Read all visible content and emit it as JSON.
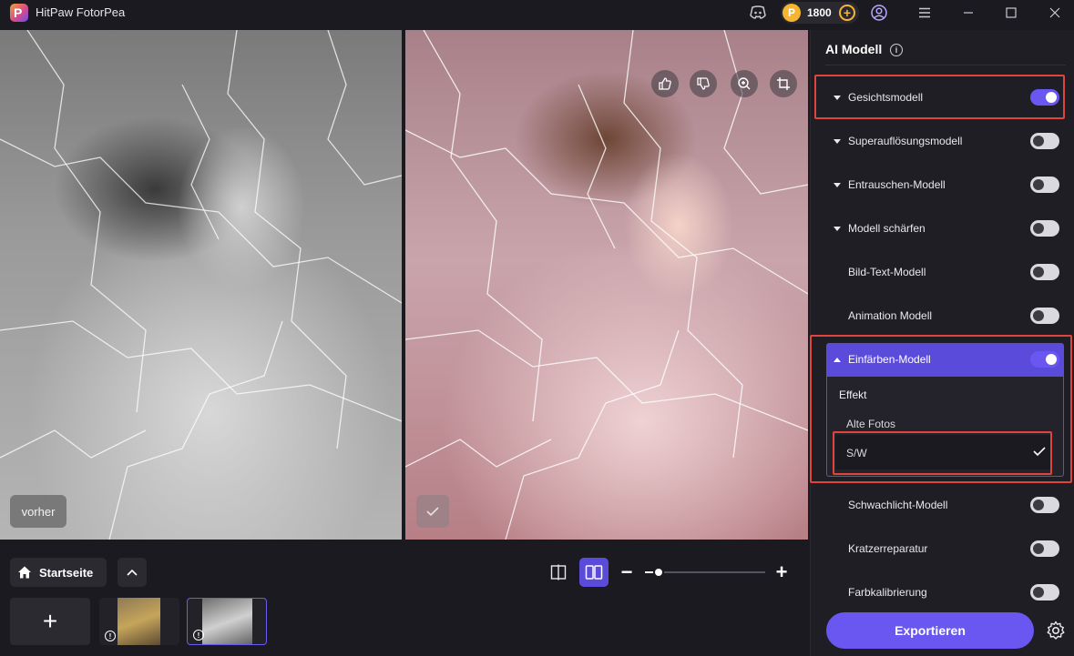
{
  "app": {
    "title": "HitPaw FotorPea",
    "logo_letter": "P"
  },
  "titlebar": {
    "credits": "1800",
    "coin_glyph": "P",
    "icons": [
      "discord-icon",
      "coin-icon",
      "add-credits-icon",
      "account-icon",
      "menu-icon",
      "minimize-icon",
      "maximize-icon",
      "close-icon"
    ]
  },
  "preview": {
    "before_label": "vorher",
    "float_buttons": [
      "thumbs-up-icon",
      "thumbs-down-icon",
      "zoom-in-icon",
      "crop-icon"
    ]
  },
  "bottombar": {
    "home_label": "Startseite",
    "zoom_level": 0.12,
    "add_label": "+"
  },
  "panel": {
    "title": "AI Modell",
    "models": [
      {
        "label": "Gesichtsmodell",
        "expandable": true,
        "on": true
      },
      {
        "label": "Superauflösungsmodell",
        "expandable": true,
        "on": false
      },
      {
        "label": "Entrauschen-Modell",
        "expandable": true,
        "on": false
      },
      {
        "label": "Modell schärfen",
        "expandable": true,
        "on": false
      },
      {
        "label": "Bild-Text-Modell",
        "expandable": false,
        "on": false
      },
      {
        "label": "Animation Modell",
        "expandable": false,
        "on": false
      },
      {
        "label": "Einfärben-Modell",
        "expandable": true,
        "on": true
      },
      {
        "label": "Schwachlicht-Modell",
        "expandable": false,
        "on": false
      },
      {
        "label": "Kratzerreparatur",
        "expandable": false,
        "on": false
      },
      {
        "label": "Farbkalibrierung",
        "expandable": false,
        "on": false
      }
    ],
    "effect": {
      "label": "Effekt",
      "options": [
        "Alte Fotos",
        "S/W"
      ],
      "selected": "S/W"
    },
    "export_label": "Exportieren"
  },
  "colors": {
    "accent": "#6a57f2",
    "highlight": "#e0453d",
    "background": "#1b1a20"
  }
}
